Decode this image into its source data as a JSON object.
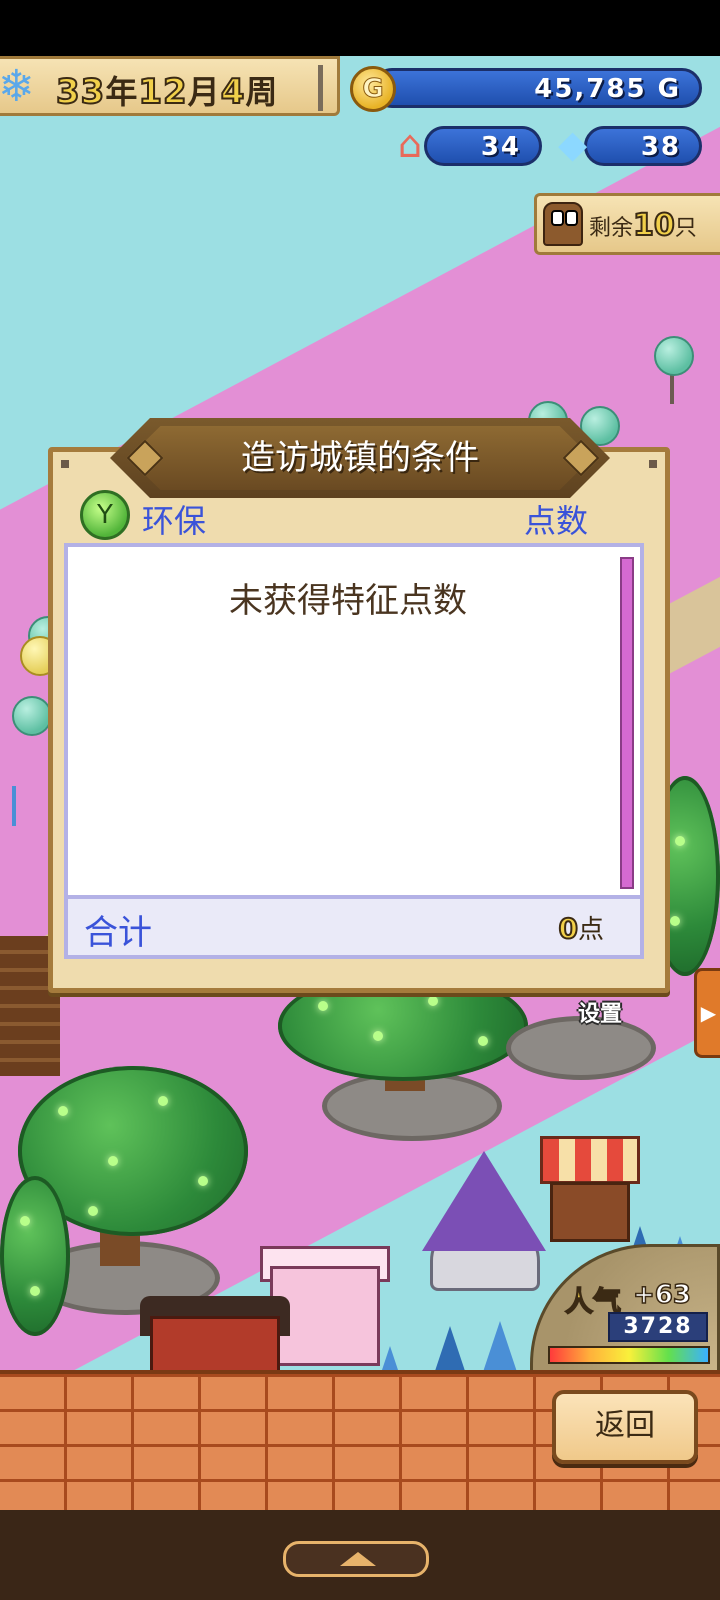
{
  "hud": {
    "season_icon": "snowflake-icon",
    "date": {
      "year_num": "33",
      "year_unit": "年",
      "month_num": "12",
      "month_unit": "月",
      "week_num": "4",
      "week_unit": "周"
    },
    "gold": {
      "icon": "G",
      "value": "45,785",
      "unit": "G"
    },
    "houses": {
      "icon": "house-icon",
      "value": "34"
    },
    "crystals": {
      "icon": "crystal-icon",
      "value": "38"
    },
    "remaining": {
      "prefix": "剩余",
      "count": "10",
      "suffix": "只"
    }
  },
  "dialog": {
    "title": "造访城镇的条件",
    "category_icon": "leaf-icon",
    "category_label": "环保",
    "points_header": "点数",
    "empty_message": "未获得特征点数",
    "total_label": "合计",
    "total_value": "0",
    "total_unit": "点"
  },
  "map": {
    "settings_label": "设置",
    "popularity": {
      "label": "人气",
      "delta": "+63",
      "score": "3728"
    }
  },
  "footer": {
    "back_label": "返回"
  },
  "colors": {
    "sky": "#9cdfe3",
    "ground": "#e38fd5",
    "dialog_bg": "#efdcae",
    "accent_blue": "#3a53d9",
    "scroll": "#d56ad1"
  }
}
